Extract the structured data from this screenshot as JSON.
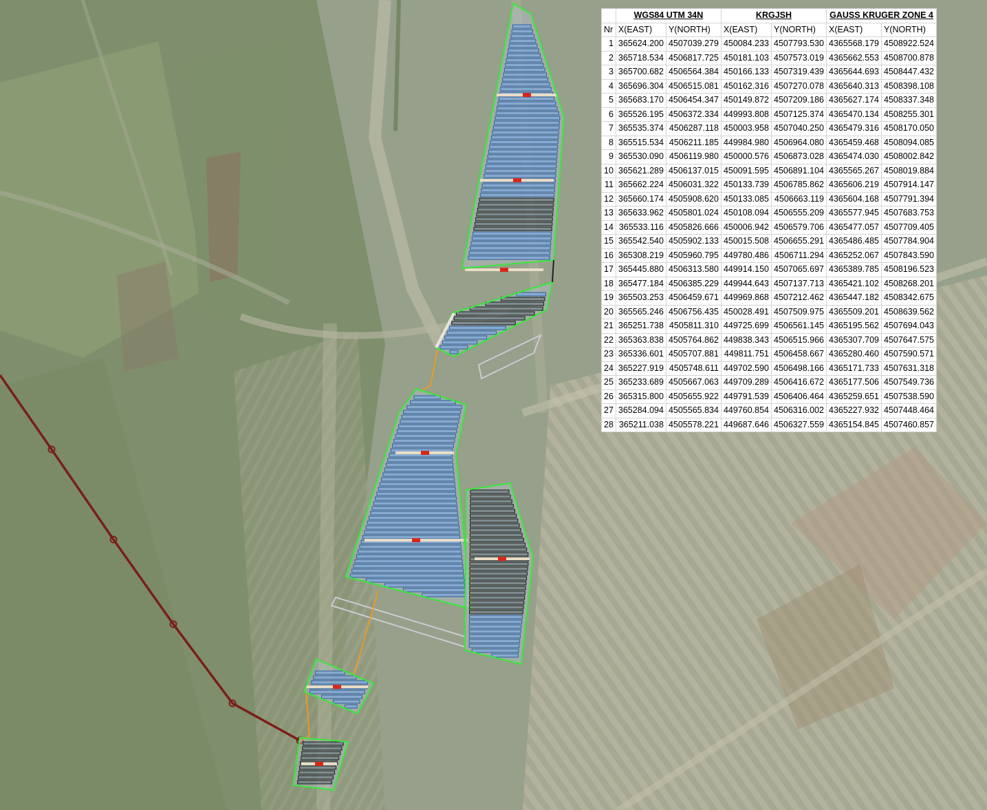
{
  "colors": {
    "parcel_outline": "#39e83a",
    "panel_fill": "#7da7d9",
    "panel_outline": "#2d5fa0",
    "panel_dark_outline": "#1a1a1a",
    "cable": "#f39a1a",
    "transmission_line": "#7a1f1a",
    "inverter": "#d4281a",
    "access_road": "#e8dcc8"
  },
  "table": {
    "systems": [
      "WGS84 UTM 34N",
      "KRGJSH",
      "GAUSS KRUGER ZONE 4"
    ],
    "nr_header": "Nr",
    "sub_headers": [
      "X(EAST)",
      "Y(NORTH)",
      "X(EAST)",
      "Y(NORTH)",
      "X(EAST)",
      "Y(NORTH)"
    ],
    "rows": [
      [
        "1",
        "365624.200",
        "4507039.279",
        "450084.233",
        "4507793.530",
        "4365568.179",
        "4508922.524"
      ],
      [
        "2",
        "365718.534",
        "4506817.725",
        "450181.103",
        "4507573.019",
        "4365662.553",
        "4508700.878"
      ],
      [
        "3",
        "365700.682",
        "4506564.384",
        "450166.133",
        "4507319.439",
        "4365644.693",
        "4508447.432"
      ],
      [
        "4",
        "365696.304",
        "4506515.081",
        "450162.316",
        "4507270.078",
        "4365640.313",
        "4508398.108"
      ],
      [
        "5",
        "365683.170",
        "4506454.347",
        "450149.872",
        "4507209.186",
        "4365627.174",
        "4508337.348"
      ],
      [
        "6",
        "365526.195",
        "4506372.334",
        "449993.808",
        "4507125.374",
        "4365470.134",
        "4508255.301"
      ],
      [
        "7",
        "365535.374",
        "4506287.118",
        "450003.958",
        "4507040.250",
        "4365479.316",
        "4508170.050"
      ],
      [
        "8",
        "365515.534",
        "4506211.185",
        "449984.980",
        "4506964.080",
        "4365459.468",
        "4508094.085"
      ],
      [
        "9",
        "365530.090",
        "4506119.980",
        "450000.576",
        "4506873.028",
        "4365474.030",
        "4508002.842"
      ],
      [
        "10",
        "365621.289",
        "4506137.015",
        "450091.595",
        "4506891.104",
        "4365565.267",
        "4508019.884"
      ],
      [
        "11",
        "365662.224",
        "4506031.322",
        "450133.739",
        "4506785.862",
        "4365606.219",
        "4507914.147"
      ],
      [
        "12",
        "365660.174",
        "4505908.620",
        "450133.085",
        "4506663.119",
        "4365604.168",
        "4507791.394"
      ],
      [
        "13",
        "365633.962",
        "4505801.024",
        "450108.094",
        "4506555.209",
        "4365577.945",
        "4507683.753"
      ],
      [
        "14",
        "365533.116",
        "4505826.666",
        "450006.942",
        "4506579.706",
        "4365477.057",
        "4507709.405"
      ],
      [
        "15",
        "365542.540",
        "4505902.133",
        "450015.508",
        "4506655.291",
        "4365486.485",
        "4507784.904"
      ],
      [
        "16",
        "365308.219",
        "4505960.795",
        "449780.486",
        "4506711.294",
        "4365252.067",
        "4507843.590"
      ],
      [
        "17",
        "365445.880",
        "4506313.580",
        "449914.150",
        "4507065.697",
        "4365389.785",
        "4508196.523"
      ],
      [
        "18",
        "365477.184",
        "4506385.229",
        "449944.643",
        "4507137.713",
        "4365421.102",
        "4508268.201"
      ],
      [
        "19",
        "365503.253",
        "4506459.671",
        "449969.868",
        "4507212.462",
        "4365447.182",
        "4508342.675"
      ],
      [
        "20",
        "365565.246",
        "4506756.435",
        "450028.491",
        "4507509.975",
        "4365509.201",
        "4508639.562"
      ],
      [
        "21",
        "365251.738",
        "4505811.310",
        "449725.699",
        "4506561.145",
        "4365195.562",
        "4507694.043"
      ],
      [
        "22",
        "365363.838",
        "4505764.862",
        "449838.343",
        "4506515.966",
        "4365307.709",
        "4507647.575"
      ],
      [
        "23",
        "365336.601",
        "4505707.881",
        "449811.751",
        "4506458.667",
        "4365280.460",
        "4507590.571"
      ],
      [
        "24",
        "365227.919",
        "4505748.611",
        "449702.590",
        "4506498.166",
        "4365171.733",
        "4507631.318"
      ],
      [
        "25",
        "365233.689",
        "4505667.063",
        "449709.289",
        "4506416.672",
        "4365177.506",
        "4507549.736"
      ],
      [
        "26",
        "365315.800",
        "4505655.922",
        "449791.539",
        "4506406.464",
        "4365259.651",
        "4507538.590"
      ],
      [
        "27",
        "365284.094",
        "4505565.834",
        "449760.854",
        "4506316.002",
        "4365227.932",
        "4507448.464"
      ],
      [
        "28",
        "365211.038",
        "4505578.221",
        "449687.646",
        "4506327.559",
        "4365154.845",
        "4507460.857"
      ]
    ]
  }
}
